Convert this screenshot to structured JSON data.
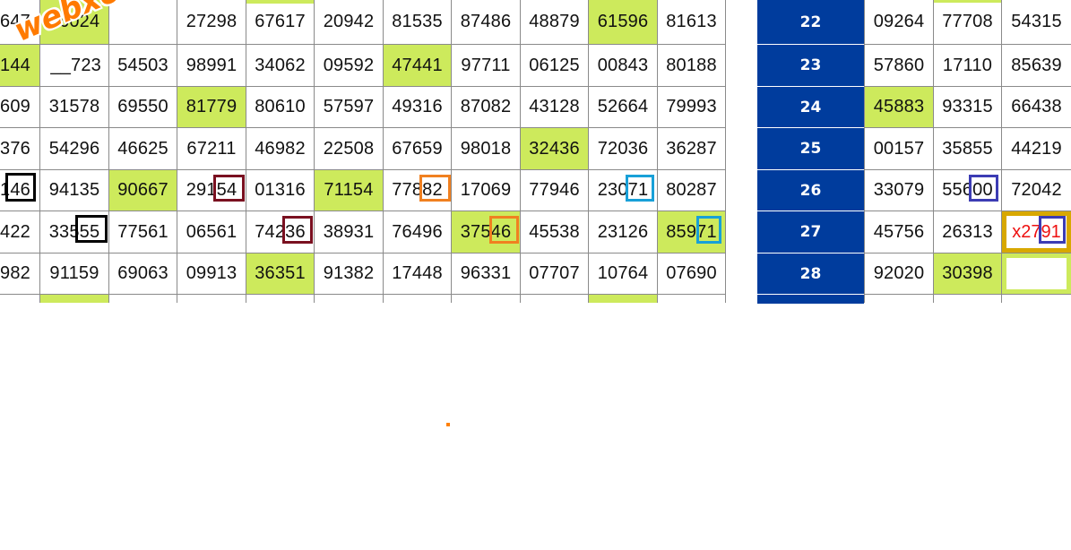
{
  "left_table": {
    "rows": [
      [
        "647",
        "46024",
        "",
        "27298",
        "67617",
        "20942",
        "81535",
        "87486",
        "48879",
        "61596",
        "81613"
      ],
      [
        "144",
        "__723",
        "54503",
        "98991",
        "34062",
        "09592",
        "47441",
        "97711",
        "06125",
        "00843",
        "80188"
      ],
      [
        "609",
        "31578",
        "69550",
        "81779",
        "80610",
        "57597",
        "49316",
        "87082",
        "43128",
        "52664",
        "79993"
      ],
      [
        "376",
        "54296",
        "46625",
        "67211",
        "46982",
        "22508",
        "67659",
        "98018",
        "32436",
        "72036",
        "36287"
      ],
      [
        "146",
        "94135",
        "90667",
        "29154",
        "01316",
        "71154",
        "77882",
        "17069",
        "77946",
        "23071",
        "80287"
      ],
      [
        "422",
        "33555",
        "77561",
        "06561",
        "74236",
        "38931",
        "76496",
        "37546",
        "45538",
        "23126",
        "85971"
      ],
      [
        "982",
        "91159",
        "69063",
        "09913",
        "36351",
        "91382",
        "17448",
        "96331",
        "07707",
        "10764",
        "07690"
      ]
    ]
  },
  "right_table": {
    "rows": [
      {
        "label": "22",
        "values": [
          "09264",
          "77708",
          "54315"
        ]
      },
      {
        "label": "23",
        "values": [
          "57860",
          "17110",
          "85639"
        ]
      },
      {
        "label": "24",
        "values": [
          "45883",
          "93315",
          "66438"
        ]
      },
      {
        "label": "25",
        "values": [
          "00157",
          "35855",
          "44219"
        ]
      },
      {
        "label": "26",
        "values": [
          "33079",
          "55600",
          "72042"
        ]
      },
      {
        "label": "27",
        "values": [
          "45756",
          "26313",
          "x2791"
        ]
      },
      {
        "label": "28",
        "values": [
          "92020",
          "30398",
          ""
        ]
      }
    ]
  },
  "watermark": {
    "text": "webxoso.net"
  },
  "colors": {
    "highlight": "#cdea5c",
    "label_bg": "#003c9d",
    "special_border": "#d8a800",
    "special_text": "#ee1111"
  }
}
